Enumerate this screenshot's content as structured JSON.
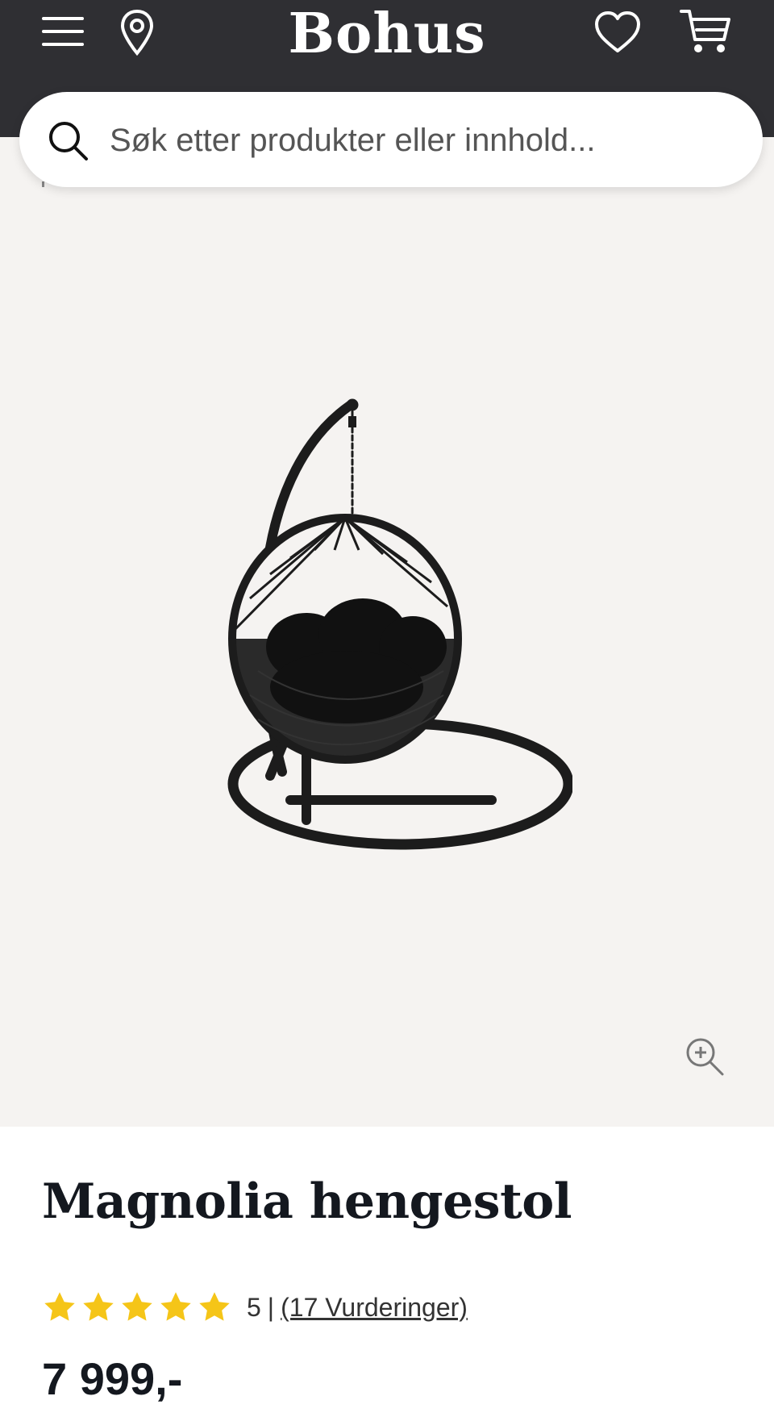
{
  "header": {
    "logo": "Bohus",
    "icons": [
      "menu-icon",
      "location-pin-icon",
      "heart-icon",
      "cart-icon"
    ],
    "bg_color": "#2f2f33"
  },
  "search": {
    "placeholder": "Søk etter produkter eller innhold..."
  },
  "gallery": {
    "main_image": "hanging-egg-chair-image",
    "zoom_icon": "zoom-in-icon",
    "thumbnails": [
      {
        "name": "thumb-product-white",
        "active": true
      },
      {
        "name": "thumb-beach-chair",
        "active": false
      },
      {
        "name": "thumb-beach-woman",
        "active": false
      },
      {
        "name": "thumb-garden",
        "active": false
      },
      {
        "name": "thumb-product-white-alt",
        "active": false
      }
    ]
  },
  "product": {
    "title": "Magnolia hengestol",
    "rating": {
      "stars": 5,
      "score": "5",
      "separator": "|",
      "reviews_label": "(17 Vurderinger)"
    },
    "price": "7 999,-",
    "star_color": "#f5c518"
  }
}
